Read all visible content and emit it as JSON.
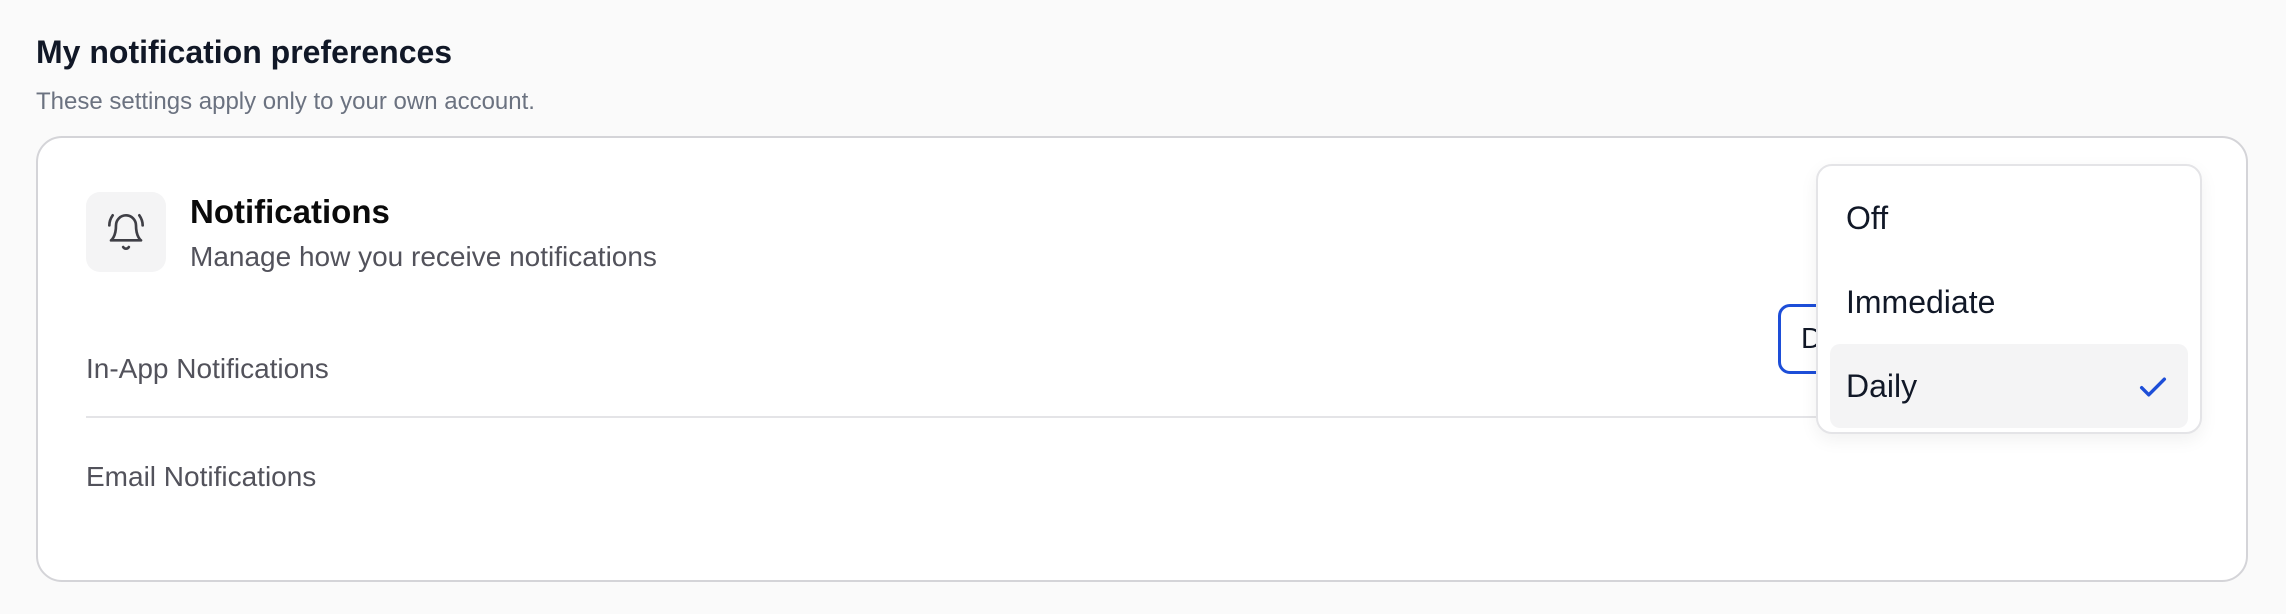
{
  "header": {
    "title": "My notification preferences",
    "subtitle": "These settings apply only to your own account."
  },
  "card": {
    "icon": "bell-icon",
    "title": "Notifications",
    "description": "Manage how you receive notifications",
    "rows": [
      {
        "label": "In-App Notifications"
      },
      {
        "label": "Email Notifications"
      }
    ]
  },
  "email_select": {
    "value": "Daily",
    "accent_color": "#1d4ed8"
  },
  "dropdown": {
    "options": [
      "Off",
      "Immediate",
      "Daily"
    ],
    "selected": "Daily",
    "check_color": "#1d4ed8"
  }
}
